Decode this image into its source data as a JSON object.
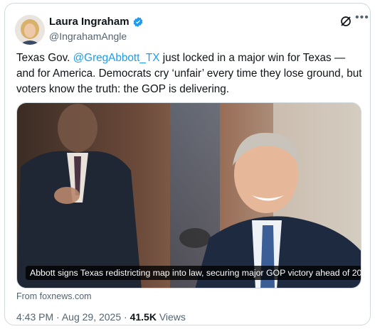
{
  "author": {
    "name": "Laura Ingraham",
    "handle": "@IngrahamAngle",
    "verified": true
  },
  "post": {
    "text_start": "Texas Gov. ",
    "mention": "@GregAbbott_TX",
    "text_rest": "  just locked in a major win for Texas — and for America. Democrats cry ‘unfair’ every time they lose ground, but voters know the truth: the GOP is delivering."
  },
  "media": {
    "caption": "Abbott signs Texas redistricting map into law, securing major GOP victory ahead of 20..."
  },
  "source": "From foxnews.com",
  "meta": {
    "time": "4:43 PM",
    "separator": "·",
    "date": "Aug 29, 2025",
    "views_count": "41.5K",
    "views_label": "Views"
  },
  "icons": [
    "verified-badge-icon",
    "grok-icon",
    "more-icon"
  ],
  "colors": {
    "accent": "#1d9bf0",
    "text": "#0f1419",
    "secondary": "#536471",
    "border": "#cfd9de"
  }
}
